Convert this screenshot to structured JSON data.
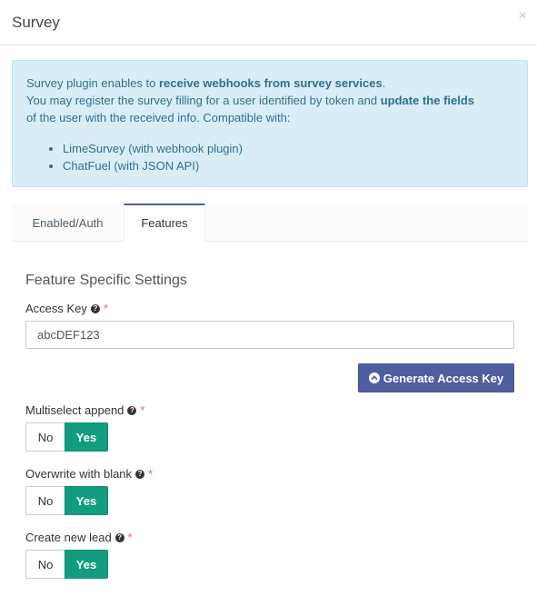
{
  "modal": {
    "title": "Survey",
    "close_symbol": "×"
  },
  "info": {
    "line1_pre": "Survey plugin enables to ",
    "line1_bold": "receive webhooks from survey services",
    "line1_post": ".",
    "line2_pre": "You may register the survey filling for a user identified by token and ",
    "line2_bold": "update the fields",
    "line3": "of the user with the received info. Compatible with:",
    "compatible": [
      "LimeSurvey (with webhook plugin)",
      "ChatFuel (with JSON API)"
    ]
  },
  "tabs": [
    {
      "label": "Enabled/Auth",
      "active": false
    },
    {
      "label": "Features",
      "active": true
    }
  ],
  "section_title": "Feature Specific Settings",
  "access_key": {
    "label": "Access Key",
    "value": "abcDEF123"
  },
  "generate_button": {
    "label": "Generate Access Key",
    "icon": "chevron-circle-up-icon"
  },
  "toggles": [
    {
      "label": "Multiselect append",
      "no_label": "No",
      "yes_label": "Yes",
      "selected": "Yes"
    },
    {
      "label": "Overwrite with blank",
      "no_label": "No",
      "yes_label": "Yes",
      "selected": "Yes"
    },
    {
      "label": "Create new lead",
      "no_label": "No",
      "yes_label": "Yes",
      "selected": "Yes"
    }
  ],
  "required_marker": "*",
  "help_icon": "?",
  "colors": {
    "info_bg": "#d9edf7",
    "info_text": "#31708f",
    "primary": "#4e5e9e",
    "success": "#139d7f",
    "required": "#ee6666"
  }
}
